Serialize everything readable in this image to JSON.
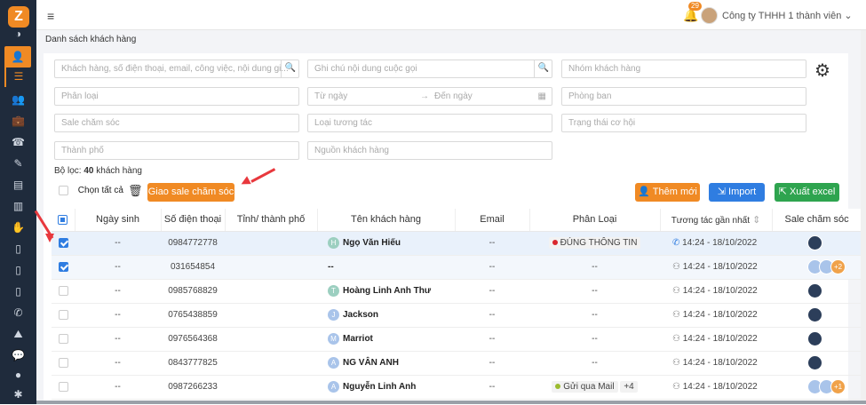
{
  "app": {
    "logo": "Z"
  },
  "sidebar": {
    "items": [
      {
        "icon": "dashboard-icon",
        "glyph": "◑"
      },
      {
        "icon": "user-icon",
        "glyph": "👤"
      },
      {
        "icon": "list-icon",
        "glyph": "☰"
      },
      {
        "icon": "users-icon",
        "glyph": "👥"
      },
      {
        "icon": "briefcase-icon",
        "glyph": "💼"
      },
      {
        "icon": "phone-book-icon",
        "glyph": "☎"
      },
      {
        "icon": "edit-document-icon",
        "glyph": "✎"
      },
      {
        "icon": "invoice-icon",
        "glyph": "▤"
      },
      {
        "icon": "chart-icon",
        "glyph": "▥"
      },
      {
        "icon": "handshake-icon",
        "glyph": "✋"
      },
      {
        "icon": "document-icon",
        "glyph": "▯"
      },
      {
        "icon": "file-icon",
        "glyph": "▯"
      },
      {
        "icon": "file-text-icon",
        "glyph": "▯"
      },
      {
        "icon": "phone-icon",
        "glyph": "✆"
      },
      {
        "icon": "map-icon",
        "glyph": "⛰"
      },
      {
        "icon": "chat-icon",
        "glyph": "💬"
      },
      {
        "icon": "person-icon",
        "glyph": "●"
      },
      {
        "icon": "settings-icon",
        "glyph": "✱"
      }
    ]
  },
  "topbar": {
    "notifications": "29",
    "company": "Công ty THHH 1 thành viên"
  },
  "breadcrumb": "Danh sách khách hàng",
  "filters": {
    "search": "Khách hàng, số điện thoại, email, công việc, nội dung gi...",
    "call_note": "Ghi chú nội dung cuộc gọi",
    "group": "Nhóm khách hàng",
    "category": "Phân loại",
    "from_date": "Từ ngày",
    "to_date": "Đến ngày",
    "department": "Phòng ban",
    "sale": "Sale chăm sóc",
    "interaction": "Loại tương tác",
    "opportunity": "Trạng thái cơ hội",
    "city": "Thành phố",
    "source": "Nguồn khách hàng"
  },
  "filter_summary": {
    "prefix": "Bộ lọc:",
    "count": "40",
    "suffix": "khách hàng"
  },
  "actions": {
    "select_all": "Chọn tất cả",
    "assign": "Giao sale chăm sóc",
    "add": "Thêm mới",
    "import": "Import",
    "export": "Xuất excel"
  },
  "colors": {
    "orange": "#f08a24",
    "blue": "#2f7de1",
    "green": "#2ea44f"
  },
  "table": {
    "headers": [
      "Ngày sinh",
      "Số điện thoại",
      "Tỉnh/ thành phố",
      "Tên khách hàng",
      "Email",
      "Phân Loại",
      "Tương tác gần nhất",
      "Sale chăm sóc"
    ],
    "rows": [
      {
        "checked": true,
        "dob": "--",
        "phone": "0984772778",
        "city": "",
        "initial": "H",
        "name": "Ngọ Văn Hiếu",
        "email": "--",
        "category": "ĐÚNG THÔNG TIN",
        "category_color": "#d9262c",
        "extra": "",
        "last": "14:24 - 18/10/2022",
        "last_icon": "phone-call-icon",
        "sale_more": ""
      },
      {
        "checked": true,
        "dob": "--",
        "phone": "031654854",
        "city": "",
        "initial": "",
        "name": "--",
        "email": "--",
        "category": "--",
        "category_color": "",
        "extra": "",
        "last": "14:24 - 18/10/2022",
        "last_icon": "meeting-icon",
        "sale_more": "+2"
      },
      {
        "checked": false,
        "dob": "--",
        "phone": "0985768829",
        "city": "",
        "initial": "T",
        "name": "Hoàng Linh Anh Thư",
        "email": "--",
        "category": "--",
        "category_color": "",
        "extra": "",
        "last": "14:24 - 18/10/2022",
        "last_icon": "meeting-icon",
        "sale_more": ""
      },
      {
        "checked": false,
        "dob": "--",
        "phone": "0765438859",
        "city": "",
        "initial": "J",
        "name": "Jackson",
        "email": "--",
        "category": "--",
        "category_color": "",
        "extra": "",
        "last": "14:24 - 18/10/2022",
        "last_icon": "meeting-icon",
        "sale_more": ""
      },
      {
        "checked": false,
        "dob": "--",
        "phone": "0976564368",
        "city": "",
        "initial": "M",
        "name": "Marriot",
        "email": "--",
        "category": "--",
        "category_color": "",
        "extra": "",
        "last": "14:24 - 18/10/2022",
        "last_icon": "meeting-icon",
        "sale_more": ""
      },
      {
        "checked": false,
        "dob": "--",
        "phone": "0843777825",
        "city": "",
        "initial": "A",
        "name": "NG VÂN ANH",
        "email": "--",
        "category": "--",
        "category_color": "",
        "extra": "",
        "last": "14:24 - 18/10/2022",
        "last_icon": "meeting-icon",
        "sale_more": ""
      },
      {
        "checked": false,
        "dob": "--",
        "phone": "0987266233",
        "city": "",
        "initial": "A",
        "name": "Nguyễn Linh Anh",
        "email": "--",
        "category": "Gửi qua Mail",
        "category_color": "#9bbb2e",
        "extra": "+4",
        "last": "14:24 - 18/10/2022",
        "last_icon": "meeting-icon",
        "sale_more": "+1"
      }
    ]
  }
}
